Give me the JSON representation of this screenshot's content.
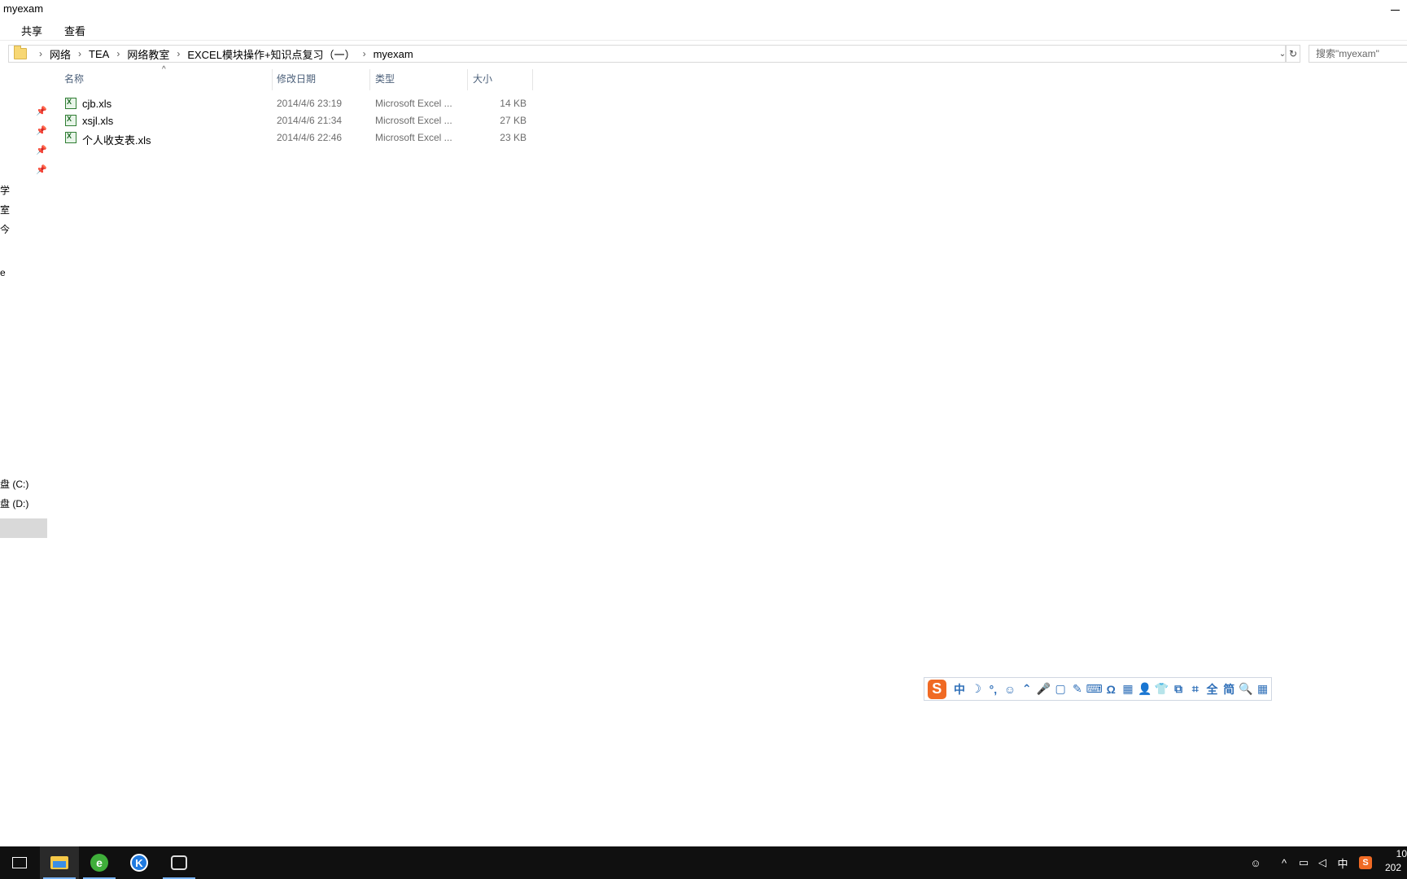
{
  "window": {
    "title": "myexam"
  },
  "ribbon": {
    "tabs": [
      "共享",
      "查看"
    ]
  },
  "address": {
    "crumbs": [
      "网络",
      "TEA",
      "网络教室",
      "EXCEL模块操作+知识点复习（一）",
      "myexam"
    ]
  },
  "search": {
    "placeholder": "搜索\"myexam\""
  },
  "columns": {
    "name": "名称",
    "date": "修改日期",
    "type": "类型",
    "size": "大小"
  },
  "files": [
    {
      "name": "cjb.xls",
      "date": "2014/4/6 23:19",
      "type": "Microsoft Excel ...",
      "size": "14 KB"
    },
    {
      "name": "xsjl.xls",
      "date": "2014/4/6 21:34",
      "type": "Microsoft Excel ...",
      "size": "27 KB"
    },
    {
      "name": "个人收支表.xls",
      "date": "2014/4/6 22:46",
      "type": "Microsoft Excel ...",
      "size": "23 KB"
    }
  ],
  "nav": {
    "fragments": [
      "学",
      "室",
      "今",
      "e"
    ],
    "drives": [
      "盘 (C:)",
      "盘 (D:)"
    ]
  },
  "ime": {
    "logo": "S",
    "items": [
      "中",
      "☽",
      "°,",
      "☺",
      "⌃",
      "🎤",
      "▢",
      "✎",
      "⌨",
      "Ω",
      "▦",
      "👤",
      "👕",
      "⧉",
      "⌗",
      "全",
      "简",
      "🔍",
      "▦"
    ]
  },
  "taskbar": {
    "green_app_letter": "e",
    "blue_app_letter": "K",
    "tray_lang": "中",
    "tray_sogou": "S",
    "clock_time": "10",
    "clock_date": "202"
  }
}
